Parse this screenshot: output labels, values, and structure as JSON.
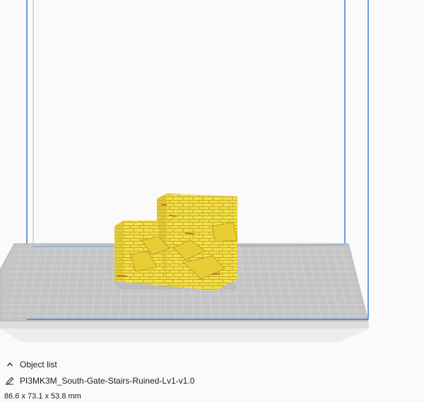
{
  "object_list": {
    "header_label": "Object list",
    "object_name": "PI3MK3M_South-Gate-Stairs-Ruined-Lv1-v1.0",
    "dimensions": "86.6 x 73.1 x 53.8 mm"
  },
  "colors": {
    "background": "#fafafa",
    "build_volume_edge": "#3b7cd6",
    "build_plate": "#c9c9c9",
    "plate_grid": "#dcdcdc",
    "model_fill": "#f1e04a",
    "model_shadow": "#c9a81f",
    "model_accent": "#c0392b"
  },
  "icons": {
    "collapse": "chevron-up-icon",
    "edit": "pencil-icon"
  }
}
